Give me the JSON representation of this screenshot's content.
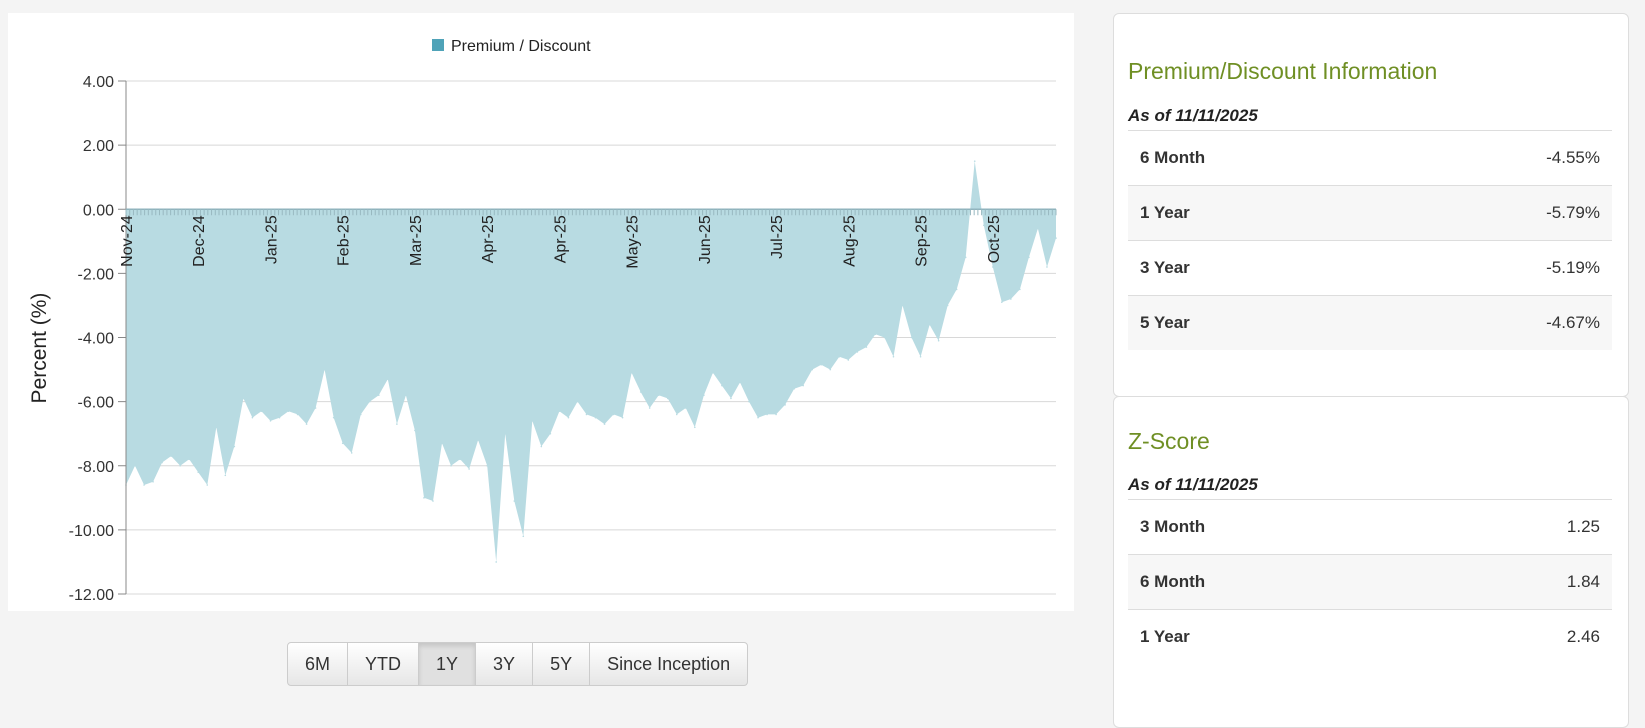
{
  "chart_data": {
    "type": "area",
    "title": "",
    "legend": {
      "label": "Premium / Discount",
      "placement": "top-center"
    },
    "ylabel": "Percent (%)",
    "xlabel": "",
    "ylim": [
      -12,
      4
    ],
    "yticks": [
      "4.00",
      "2.00",
      "0.00",
      "-2.00",
      "-4.00",
      "-6.00",
      "-8.00",
      "-10.00",
      "-12.00"
    ],
    "ytick_values": [
      4,
      2,
      0,
      -2,
      -4,
      -6,
      -8,
      -10,
      -12
    ],
    "grid": true,
    "points_per_label": 8,
    "x_labels": [
      "Nov-24",
      "Dec-24",
      "Jan-25",
      "Feb-25",
      "Mar-25",
      "Apr-25",
      "Apr-25",
      "May-25",
      "Jun-25",
      "Jul-25",
      "Aug-25",
      "Sep-25",
      "Oct-25"
    ],
    "series": [
      {
        "name": "Premium / Discount",
        "color": "#4fa3b8",
        "fill": "#b8dbe2",
        "values": [
          -8.6,
          -8.0,
          -8.6,
          -8.5,
          -7.9,
          -7.7,
          -8.0,
          -7.8,
          -8.2,
          -8.6,
          -6.8,
          -8.3,
          -7.4,
          -5.9,
          -6.5,
          -6.3,
          -6.6,
          -6.5,
          -6.3,
          -6.4,
          -6.7,
          -6.2,
          -5.0,
          -6.5,
          -7.3,
          -7.6,
          -6.4,
          -6.0,
          -5.8,
          -5.3,
          -6.7,
          -5.8,
          -6.9,
          -9.0,
          -9.1,
          -7.3,
          -8.0,
          -7.8,
          -8.1,
          -7.2,
          -8.0,
          -11.0,
          -7.0,
          -9.1,
          -10.2,
          -6.6,
          -7.4,
          -7.0,
          -6.3,
          -6.5,
          -6.0,
          -6.4,
          -6.5,
          -6.7,
          -6.4,
          -6.5,
          -5.1,
          -5.7,
          -6.2,
          -5.8,
          -5.9,
          -6.4,
          -6.2,
          -6.8,
          -5.8,
          -5.1,
          -5.5,
          -5.9,
          -5.4,
          -6.0,
          -6.5,
          -6.4,
          -6.4,
          -6.1,
          -5.6,
          -5.5,
          -5.0,
          -4.85,
          -5.0,
          -4.6,
          -4.7,
          -4.45,
          -4.3,
          -3.9,
          -4.0,
          -4.6,
          -3.0,
          -4.0,
          -4.6,
          -3.6,
          -4.1,
          -3.0,
          -2.5,
          -1.5,
          1.5,
          -0.5,
          -1.8,
          -2.9,
          -2.8,
          -2.5,
          -1.5,
          -0.6,
          -1.8,
          -0.9
        ]
      }
    ]
  },
  "range_buttons": [
    {
      "label": "6M",
      "active": false
    },
    {
      "label": "YTD",
      "active": false
    },
    {
      "label": "1Y",
      "active": true
    },
    {
      "label": "3Y",
      "active": false
    },
    {
      "label": "5Y",
      "active": false
    },
    {
      "label": "Since Inception",
      "active": false
    }
  ],
  "premium_discount": {
    "title": "Premium/Discount Information",
    "as_of": "As of 11/11/2025",
    "rows": [
      {
        "label": "6 Month",
        "value": "-4.55%"
      },
      {
        "label": "1 Year",
        "value": "-5.79%"
      },
      {
        "label": "3 Year",
        "value": "-5.19%"
      },
      {
        "label": "5 Year",
        "value": "-4.67%"
      }
    ]
  },
  "z_score": {
    "title": "Z-Score",
    "as_of": "As of 11/11/2025",
    "rows": [
      {
        "label": "3 Month",
        "value": "1.25"
      },
      {
        "label": "6 Month",
        "value": "1.84"
      },
      {
        "label": "1 Year",
        "value": "2.46"
      }
    ]
  }
}
